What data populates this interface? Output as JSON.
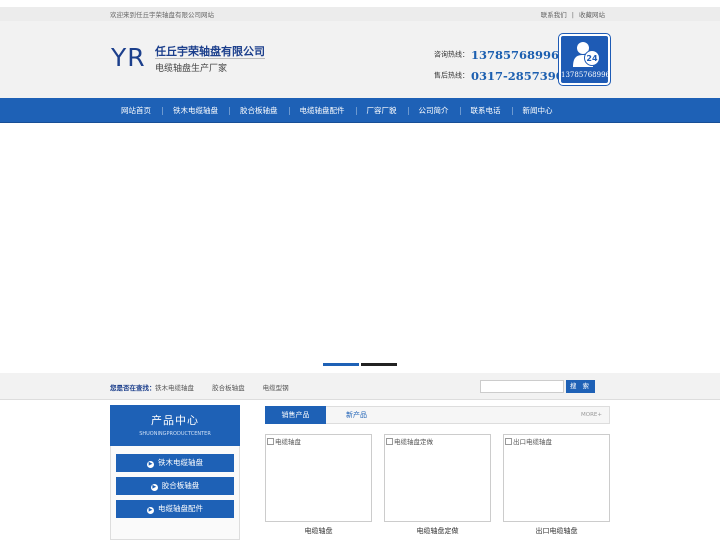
{
  "topbar": {
    "welcome": "欢迎来到任丘宇荣轴盘有限公司网站",
    "links": [
      "联系我们",
      "收藏网站"
    ]
  },
  "header": {
    "logo_mark": "YR",
    "company_name": "任丘宇荣轴盘有限公司",
    "slogan": "电缆轴盘生产厂家",
    "hotlines": [
      {
        "label": "咨询热线：",
        "number": "13785768996"
      },
      {
        "label": "售后热线：",
        "number": "0317-2857390"
      }
    ],
    "badge": {
      "icon": "user-24-icon",
      "badge_text": "24",
      "number": "13785768996"
    }
  },
  "nav": {
    "items": [
      "网站首页",
      "铁木电缆轴盘",
      "胶合板轴盘",
      "电缆轴盘配件",
      "厂容厂貌",
      "公司简介",
      "联系电话",
      "新闻中心"
    ]
  },
  "search": {
    "hot_label": "您是否在查找：",
    "hot_items": [
      "铁木电缆轴盘",
      "胶合板轴盘",
      "电缆型钢"
    ],
    "input_value": "",
    "button_label": "搜 索"
  },
  "sidebar": {
    "title": "产品中心",
    "subtitle": "SHUONINGPRODUCTCENTER",
    "items": [
      "铁木电缆轴盘",
      "胶合板轴盘",
      "电缆轴盘配件"
    ]
  },
  "products": {
    "tabs": [
      "销售产品",
      "新产品"
    ],
    "more": "MORE+",
    "items": [
      {
        "alt": "电缆轴盘",
        "caption": "电缆轴盘"
      },
      {
        "alt": "电缆轴盘定做",
        "caption": "电缆轴盘定做"
      },
      {
        "alt": "出口电缆轴盘",
        "caption": "出口电缆轴盘"
      }
    ]
  },
  "colors": {
    "brand_blue": "#1e61b6",
    "dark_blue": "#1c3f8c",
    "topbar_bg": "#ececec",
    "header_bg": "#f2f2f2"
  }
}
